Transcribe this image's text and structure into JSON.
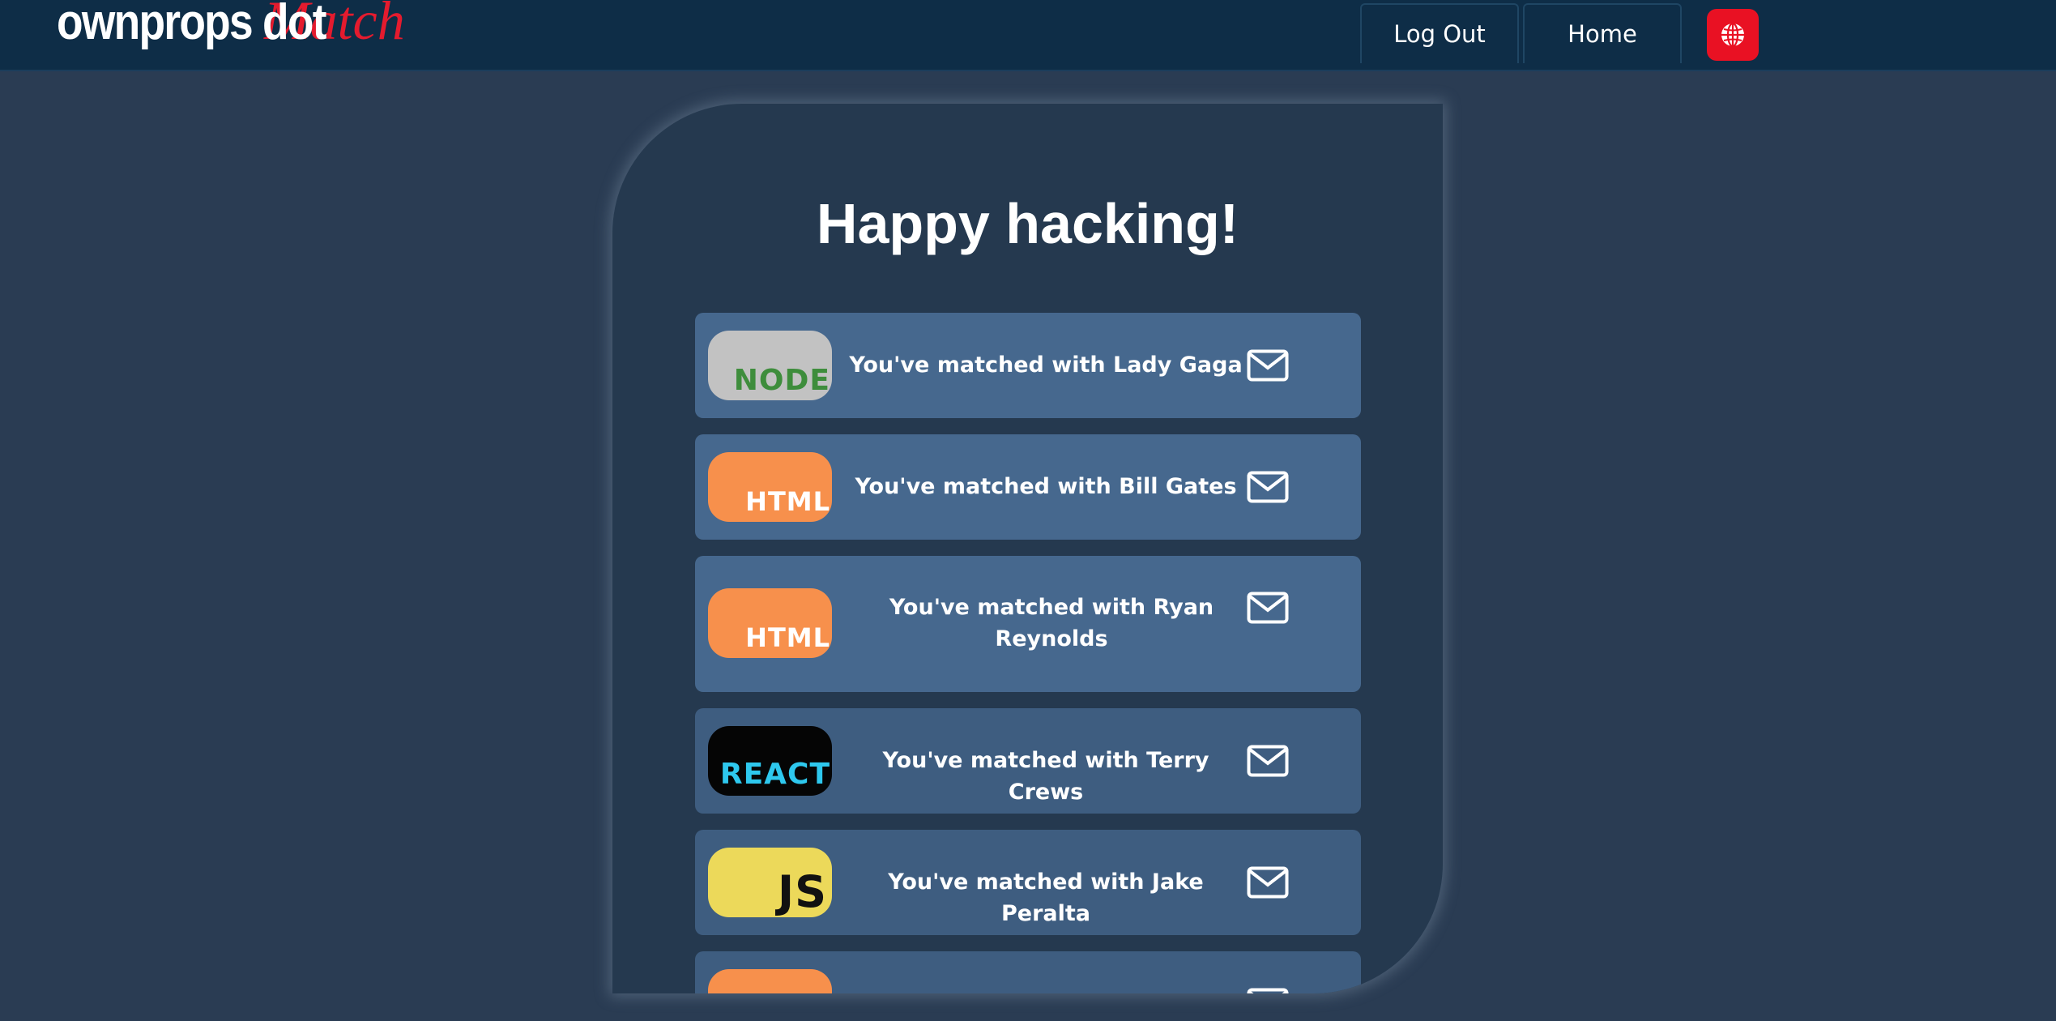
{
  "header": {
    "logo_main": "ownprops dot",
    "logo_accent": "Match",
    "logout_label": "Log Out",
    "home_label": "Home",
    "language_icon": "globe-icon"
  },
  "colors": {
    "navbar": "#0e2d47",
    "page_bg": "#2a3c53",
    "card_bg": "#25394f",
    "row_bg": "#46688e",
    "accent_red": "#e41b2e"
  },
  "main": {
    "title": "Happy hacking!",
    "matches": [
      {
        "logo_text": "NODE",
        "text": "You've matched with Lady Gaga",
        "icon": "mail-icon"
      },
      {
        "logo_text": "HTML",
        "text": "You've matched with Bill Gates",
        "icon": "mail-icon"
      },
      {
        "logo_text": "HTML",
        "text": "You've matched with Ryan Reynolds",
        "icon": "mail-icon"
      },
      {
        "logo_text": "REACT",
        "text": "You've matched with Terry Crews",
        "icon": "mail-icon"
      },
      {
        "logo_text": "JS",
        "text": "You've matched with Jake Peralta",
        "icon": "mail-icon"
      },
      {
        "logo_text": "",
        "text": "",
        "icon": "mail-icon"
      }
    ]
  }
}
